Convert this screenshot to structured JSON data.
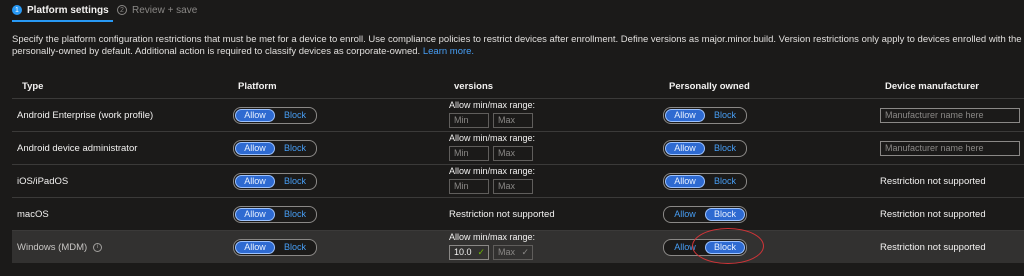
{
  "wizard": {
    "steps": [
      {
        "number": "1",
        "label": "Platform settings"
      },
      {
        "number": "2",
        "label": "Review + save"
      }
    ]
  },
  "description": {
    "text": "Specify the platform configuration restrictions that must be met for a device to enroll. Use compliance policies to restrict devices after enrollment. Define versions as major.minor.build. Version restrictions only apply to devices enrolled with the Company Portal. Intune cla",
    "text2": "personally-owned by default. Additional action is required to classify devices as corporate-owned.",
    "link": "Learn more."
  },
  "table": {
    "headers": {
      "type": "Type",
      "platform": "Platform",
      "versions": "versions",
      "personal": "Personally owned",
      "manufacturer": "Device manufacturer"
    },
    "toggle_labels": {
      "allow": "Allow",
      "block": "Block"
    },
    "range_label": "Allow min/max range:",
    "min_placeholder": "Min",
    "max_placeholder": "Max",
    "manufacturer_placeholder": "Manufacturer name here",
    "not_supported": "Restriction not supported",
    "rows": [
      {
        "type": "Android Enterprise (work profile)",
        "platform": "Allow",
        "personal": "Allow"
      },
      {
        "type": "Android device administrator",
        "platform": "Allow",
        "personal": "Allow"
      },
      {
        "type": "iOS/iPadOS",
        "platform": "Allow",
        "personal": "Allow"
      },
      {
        "type": "macOS",
        "platform": "Allow",
        "personal": "Block"
      },
      {
        "type": "Windows (MDM)",
        "platform": "Allow",
        "personal": "Block",
        "min_value": "10.0"
      }
    ]
  },
  "colors": {
    "accent": "#2899f5",
    "selected_segment": "#2e6ad1",
    "highlight_circle": "#d13438",
    "valid_check": "#6bb700"
  }
}
